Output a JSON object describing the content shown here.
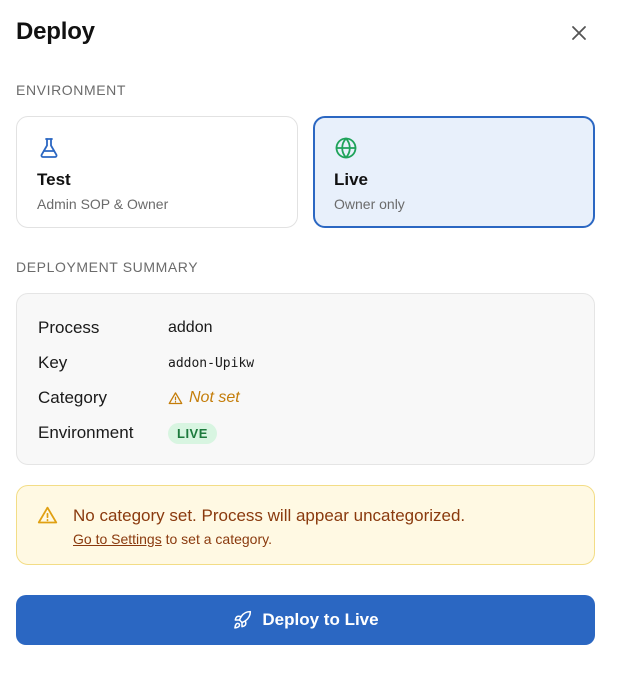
{
  "dialog": {
    "title": "Deploy",
    "close_icon": "close-icon"
  },
  "environment": {
    "section_label": "ENVIRONMENT",
    "options": [
      {
        "title": "Test",
        "subtitle": "Admin SOP & Owner",
        "icon": "flask-icon",
        "icon_color": "#2b67c2",
        "selected": false
      },
      {
        "title": "Live",
        "subtitle": "Owner only",
        "icon": "globe-icon",
        "icon_color": "#1fa35a",
        "selected": true
      }
    ]
  },
  "summary": {
    "section_label": "DEPLOYMENT SUMMARY",
    "rows": [
      {
        "key": "Process",
        "value": "addon"
      },
      {
        "key": "Key",
        "value": "addon-Upikw"
      },
      {
        "key": "Category",
        "value": "Not set"
      },
      {
        "key": "Environment",
        "value": "LIVE"
      }
    ]
  },
  "warning": {
    "message": "No category set. Process will appear uncategorized.",
    "link_text": "Go to Settings",
    "link_suffix": " to set a category.",
    "icon": "warning-icon"
  },
  "deploy_button": {
    "label": "Deploy to Live",
    "icon": "rocket-icon"
  },
  "colors": {
    "accent": "#2b67c2",
    "selected_bg": "#e8f0fb",
    "live_badge_bg": "#d8f5e1",
    "live_badge_text": "#1c7a3c",
    "warning_bg": "#fff9e3",
    "warning_text": "#8a3a0e",
    "notset_text": "#c47d0a"
  }
}
